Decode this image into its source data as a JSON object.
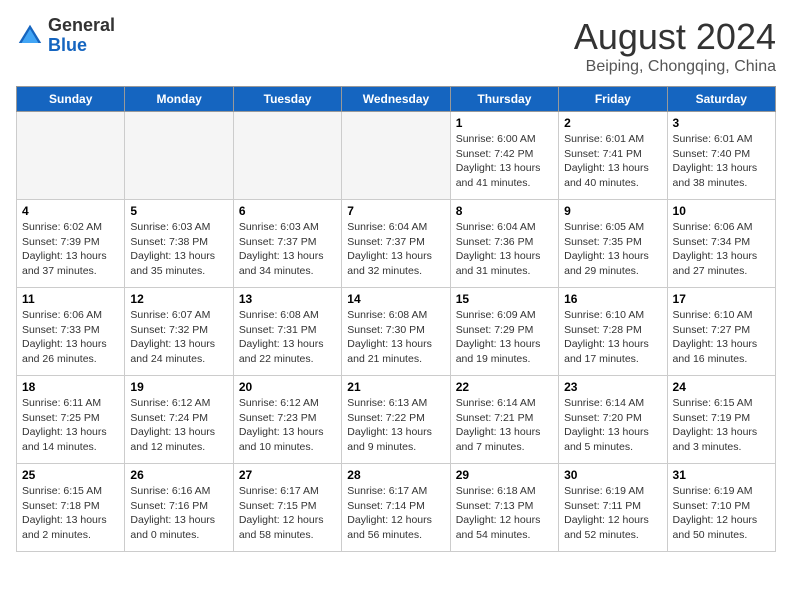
{
  "header": {
    "logo_general": "General",
    "logo_blue": "Blue",
    "title": "August 2024",
    "subtitle": "Beiping, Chongqing, China"
  },
  "days_of_week": [
    "Sunday",
    "Monday",
    "Tuesday",
    "Wednesday",
    "Thursday",
    "Friday",
    "Saturday"
  ],
  "weeks": [
    [
      {
        "day": "",
        "empty": true
      },
      {
        "day": "",
        "empty": true
      },
      {
        "day": "",
        "empty": true
      },
      {
        "day": "",
        "empty": true
      },
      {
        "day": "1",
        "sunrise": "6:00 AM",
        "sunset": "7:42 PM",
        "daylight": "13 hours and 41 minutes."
      },
      {
        "day": "2",
        "sunrise": "6:01 AM",
        "sunset": "7:41 PM",
        "daylight": "13 hours and 40 minutes."
      },
      {
        "day": "3",
        "sunrise": "6:01 AM",
        "sunset": "7:40 PM",
        "daylight": "13 hours and 38 minutes."
      }
    ],
    [
      {
        "day": "4",
        "sunrise": "6:02 AM",
        "sunset": "7:39 PM",
        "daylight": "13 hours and 37 minutes."
      },
      {
        "day": "5",
        "sunrise": "6:03 AM",
        "sunset": "7:38 PM",
        "daylight": "13 hours and 35 minutes."
      },
      {
        "day": "6",
        "sunrise": "6:03 AM",
        "sunset": "7:37 PM",
        "daylight": "13 hours and 34 minutes."
      },
      {
        "day": "7",
        "sunrise": "6:04 AM",
        "sunset": "7:37 PM",
        "daylight": "13 hours and 32 minutes."
      },
      {
        "day": "8",
        "sunrise": "6:04 AM",
        "sunset": "7:36 PM",
        "daylight": "13 hours and 31 minutes."
      },
      {
        "day": "9",
        "sunrise": "6:05 AM",
        "sunset": "7:35 PM",
        "daylight": "13 hours and 29 minutes."
      },
      {
        "day": "10",
        "sunrise": "6:06 AM",
        "sunset": "7:34 PM",
        "daylight": "13 hours and 27 minutes."
      }
    ],
    [
      {
        "day": "11",
        "sunrise": "6:06 AM",
        "sunset": "7:33 PM",
        "daylight": "13 hours and 26 minutes."
      },
      {
        "day": "12",
        "sunrise": "6:07 AM",
        "sunset": "7:32 PM",
        "daylight": "13 hours and 24 minutes."
      },
      {
        "day": "13",
        "sunrise": "6:08 AM",
        "sunset": "7:31 PM",
        "daylight": "13 hours and 22 minutes."
      },
      {
        "day": "14",
        "sunrise": "6:08 AM",
        "sunset": "7:30 PM",
        "daylight": "13 hours and 21 minutes."
      },
      {
        "day": "15",
        "sunrise": "6:09 AM",
        "sunset": "7:29 PM",
        "daylight": "13 hours and 19 minutes."
      },
      {
        "day": "16",
        "sunrise": "6:10 AM",
        "sunset": "7:28 PM",
        "daylight": "13 hours and 17 minutes."
      },
      {
        "day": "17",
        "sunrise": "6:10 AM",
        "sunset": "7:27 PM",
        "daylight": "13 hours and 16 minutes."
      }
    ],
    [
      {
        "day": "18",
        "sunrise": "6:11 AM",
        "sunset": "7:25 PM",
        "daylight": "13 hours and 14 minutes."
      },
      {
        "day": "19",
        "sunrise": "6:12 AM",
        "sunset": "7:24 PM",
        "daylight": "13 hours and 12 minutes."
      },
      {
        "day": "20",
        "sunrise": "6:12 AM",
        "sunset": "7:23 PM",
        "daylight": "13 hours and 10 minutes."
      },
      {
        "day": "21",
        "sunrise": "6:13 AM",
        "sunset": "7:22 PM",
        "daylight": "13 hours and 9 minutes."
      },
      {
        "day": "22",
        "sunrise": "6:14 AM",
        "sunset": "7:21 PM",
        "daylight": "13 hours and 7 minutes."
      },
      {
        "day": "23",
        "sunrise": "6:14 AM",
        "sunset": "7:20 PM",
        "daylight": "13 hours and 5 minutes."
      },
      {
        "day": "24",
        "sunrise": "6:15 AM",
        "sunset": "7:19 PM",
        "daylight": "13 hours and 3 minutes."
      }
    ],
    [
      {
        "day": "25",
        "sunrise": "6:15 AM",
        "sunset": "7:18 PM",
        "daylight": "13 hours and 2 minutes."
      },
      {
        "day": "26",
        "sunrise": "6:16 AM",
        "sunset": "7:16 PM",
        "daylight": "13 hours and 0 minutes."
      },
      {
        "day": "27",
        "sunrise": "6:17 AM",
        "sunset": "7:15 PM",
        "daylight": "12 hours and 58 minutes."
      },
      {
        "day": "28",
        "sunrise": "6:17 AM",
        "sunset": "7:14 PM",
        "daylight": "12 hours and 56 minutes."
      },
      {
        "day": "29",
        "sunrise": "6:18 AM",
        "sunset": "7:13 PM",
        "daylight": "12 hours and 54 minutes."
      },
      {
        "day": "30",
        "sunrise": "6:19 AM",
        "sunset": "7:11 PM",
        "daylight": "12 hours and 52 minutes."
      },
      {
        "day": "31",
        "sunrise": "6:19 AM",
        "sunset": "7:10 PM",
        "daylight": "12 hours and 50 minutes."
      }
    ]
  ]
}
